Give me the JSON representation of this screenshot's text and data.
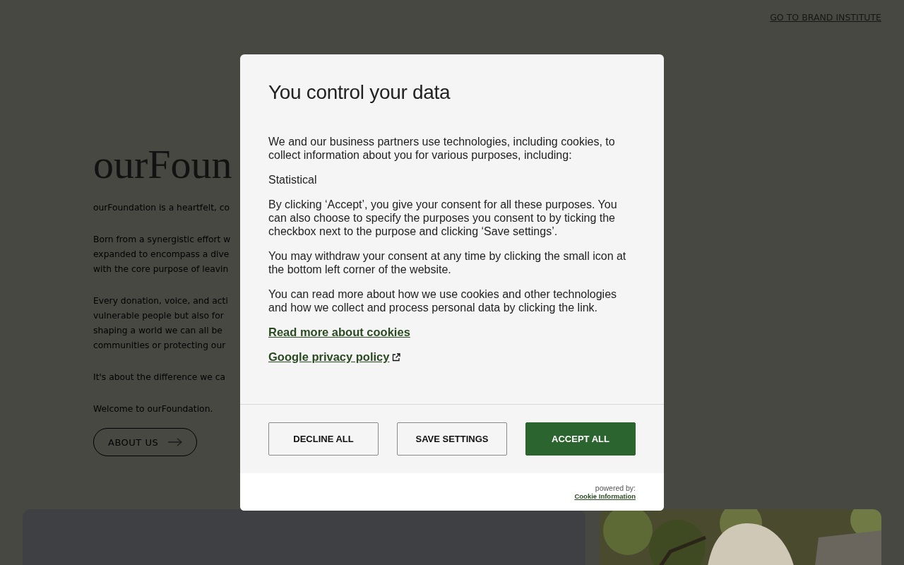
{
  "header": {
    "link": "GO TO BRAND INSTITUTE"
  },
  "intro": {
    "heading": "ourFoun",
    "paragraphs": [
      [
        "ourFoundation is a heartfelt, co"
      ],
      [
        "Born from a synergistic effort w",
        "expanded to encompass a dive",
        "with the core purpose of leavin"
      ],
      [
        "Every donation, voice, and acti",
        "vulnerable people but also for",
        "shaping a world we can all be",
        "communities or protecting our"
      ],
      [
        "It's about the difference we ca"
      ],
      [
        "Welcome to ourFoundation."
      ]
    ],
    "button": "ABOUT US"
  },
  "cards": [
    {
      "kind": "panel"
    },
    {
      "kind": "picture"
    }
  ],
  "consent_dialog": {
    "title": "You control your data",
    "paragraphs": [
      "We and our business partners use technologies, including cookies, to collect information about you for various purposes, including:",
      "Statistical",
      "By clicking ‘Accept’, you give your consent for all these purposes. You can also choose to specify the purposes you consent to by ticking the checkbox next to the purpose and clicking ‘Save settings’.",
      "You may withdraw your consent at any time by clicking the small icon at the bottom left corner of the website.",
      "You can read more about how we use cookies and other technologies and how we collect and process personal data by clicking the link."
    ],
    "links": [
      {
        "label": "Read more about cookies",
        "kind": "plain"
      },
      {
        "label": "Google privacy policy",
        "kind": "external"
      }
    ],
    "buttons": [
      {
        "label": "DECLINE ALL",
        "kind": "outline"
      },
      {
        "label": "SAVE SETTINGS",
        "kind": "outline"
      },
      {
        "label": "ACCEPT ALL",
        "kind": "primary"
      }
    ],
    "powered_by": "powered by:",
    "powered_link": "Cookie Information"
  }
}
